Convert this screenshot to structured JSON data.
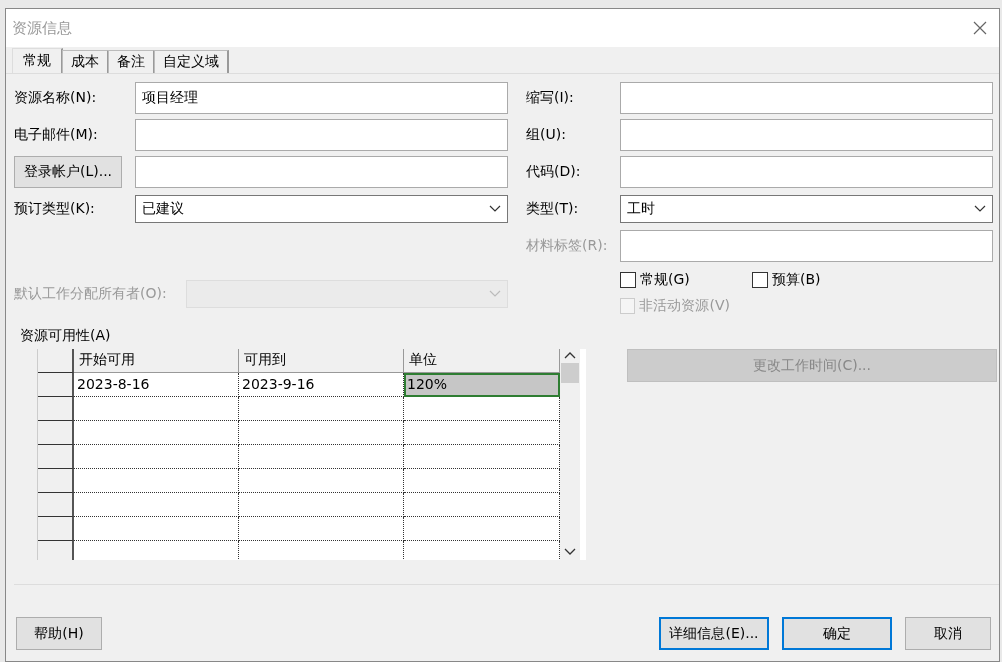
{
  "window": {
    "title": "资源信息"
  },
  "tabs": [
    {
      "label": "常规",
      "selected": true
    },
    {
      "label": "成本",
      "selected": false
    },
    {
      "label": "备注",
      "selected": false
    },
    {
      "label": "自定义域",
      "selected": false
    }
  ],
  "left_fields": [
    {
      "kind": "text",
      "label": "资源名称(N):",
      "value": "项目经理",
      "disabled": false
    },
    {
      "kind": "text",
      "label": "电子邮件(M):",
      "disabled": false
    },
    {
      "kind": "button",
      "label": "登录帐户(L)...",
      "disabled": false
    },
    {
      "kind": "select",
      "label": "预订类型(K):",
      "value": "已建议",
      "disabled": false
    }
  ],
  "owner_field": {
    "kind": "select",
    "label": "默认工作分配所有者(O):",
    "disabled": true
  },
  "right_fields": [
    {
      "kind": "text",
      "label": "缩写(I):",
      "disabled": false
    },
    {
      "kind": "text",
      "label": "组(U):",
      "disabled": false
    },
    {
      "kind": "text",
      "label": "代码(D):",
      "disabled": false
    },
    {
      "kind": "select",
      "label": "类型(T):",
      "value": "工时",
      "disabled": false
    },
    {
      "kind": "text",
      "label": "材料标签(R):",
      "disabled": true
    }
  ],
  "checkboxes": [
    {
      "label": "常规(G)",
      "checked": false,
      "disabled": false
    },
    {
      "label": "预算(B)",
      "checked": false,
      "disabled": false
    },
    {
      "label": "非活动资源(V)",
      "checked": false,
      "disabled": true
    }
  ],
  "availability": {
    "label": "资源可用性(A)",
    "columns": [
      "开始可用",
      "可用到",
      "单位"
    ],
    "rows": [
      {
        "cells": [
          {
            "text": "2023-8-16",
            "selected": false
          },
          {
            "text": "2023-9-16",
            "selected": false
          },
          {
            "text": "120%",
            "selected": true
          }
        ]
      }
    ]
  },
  "change_button": {
    "label": "更改工作时间(C)...",
    "disabled": true
  },
  "buttons": [
    {
      "kind": "help",
      "label": "帮助(H)",
      "focused": false
    },
    {
      "kind": "action",
      "label": "详细信息(E)...",
      "focused": true
    },
    {
      "kind": "action",
      "label": "确定",
      "focused": true
    },
    {
      "kind": "action",
      "label": "取消",
      "focused": false
    }
  ]
}
